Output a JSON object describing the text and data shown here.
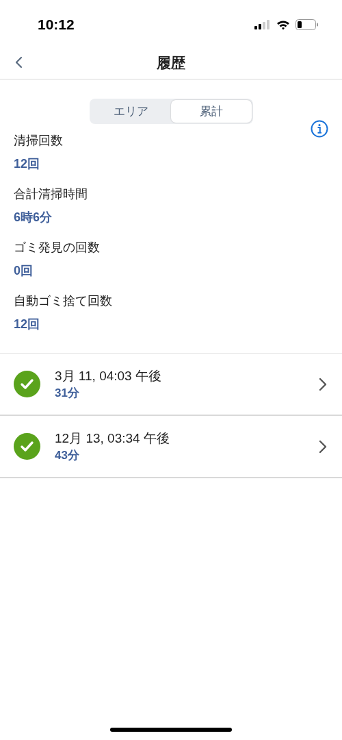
{
  "status_bar": {
    "time": "10:12"
  },
  "nav": {
    "title": "履歴"
  },
  "tabs": [
    {
      "label": "エリア",
      "selected": false
    },
    {
      "label": "累計",
      "selected": true
    }
  ],
  "stats": [
    {
      "label": "清掃回数",
      "value": "12回"
    },
    {
      "label": "合計清掃時間",
      "value": "6時6分"
    },
    {
      "label": "ゴミ発見の回数",
      "value": "0回"
    },
    {
      "label": "自動ゴミ捨て回数",
      "value": "12回"
    }
  ],
  "sessions": [
    {
      "date": "3月 11, 04:03 午後",
      "duration": "31分",
      "done": true
    },
    {
      "date": "12月 13, 03:34 午後",
      "duration": "43分",
      "done": true
    }
  ]
}
